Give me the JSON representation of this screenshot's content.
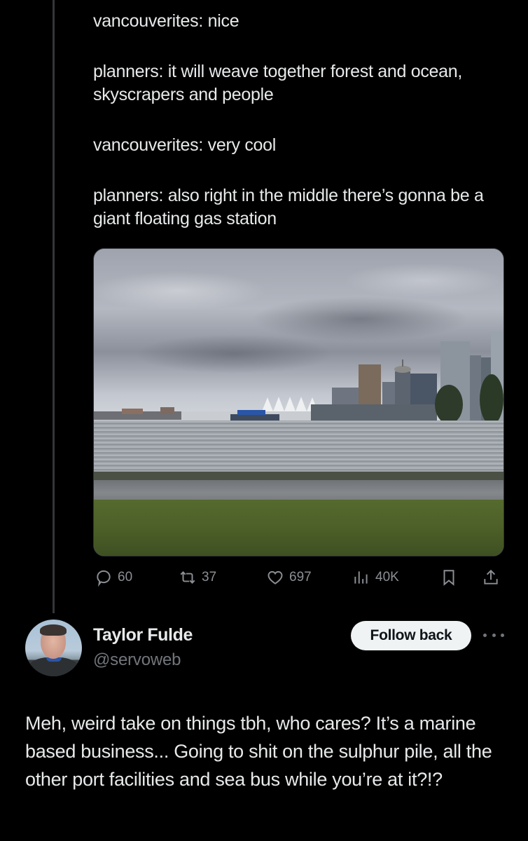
{
  "parent_tweet": {
    "text_paragraphs": [
      "vancouverites: nice",
      "planners: it will weave together forest and ocean, skyscrapers and people",
      "vancouverites: very cool",
      "planners: also right in the middle there’s gonna be a giant floating gas station"
    ],
    "media": {
      "description": "Overcast view across Coal Harbour toward downtown Vancouver skyline with Canada Place sails and a floating gas station, seawall path and grass in foreground"
    },
    "actions": {
      "reply": {
        "icon": "reply-bubble-icon",
        "count": "60"
      },
      "repost": {
        "icon": "repost-icon",
        "count": "37"
      },
      "like": {
        "icon": "heart-icon",
        "count": "697"
      },
      "views": {
        "icon": "views-bar-chart-icon",
        "count": "40K"
      },
      "bookmark": {
        "icon": "bookmark-icon"
      },
      "share": {
        "icon": "share-upload-icon"
      }
    }
  },
  "reply_tweet": {
    "author": {
      "name": "Taylor Fulde",
      "handle": "@servoweb"
    },
    "follow_button_label": "Follow back",
    "more_icon": "more-horizontal-icon",
    "text": "Meh, weird take on things tbh, who cares? It’s a marine based business... Going to shit on the sulphur pile, all the other port facilities and sea bus while you’re at it?!?"
  },
  "colors": {
    "background": "#000000",
    "primary_text": "#e7e9ea",
    "secondary_text": "#71767b",
    "icon_gray": "#8b8f94",
    "thread_line": "#333639",
    "follow_button_bg": "#eff3f4",
    "follow_button_text": "#0f1419"
  }
}
